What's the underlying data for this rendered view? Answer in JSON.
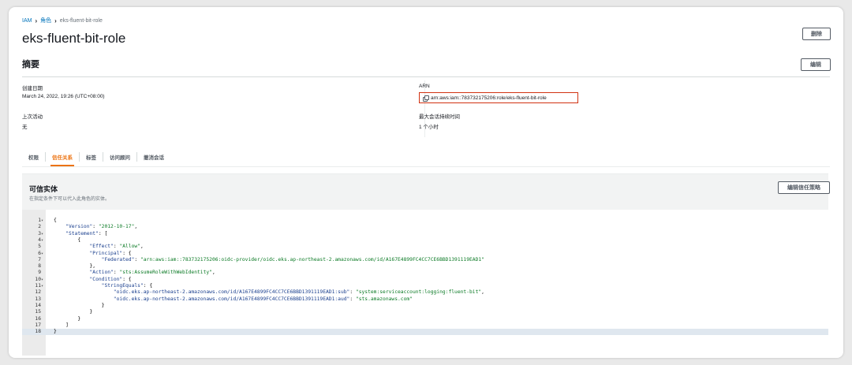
{
  "breadcrumb": [
    "IAM",
    "角色",
    "eks-fluent-bit-role"
  ],
  "page_title": "eks-fluent-bit-role",
  "buttons": {
    "delete": "删除",
    "edit": "编辑",
    "edit_trust_policy": "编辑信任策略"
  },
  "summary": {
    "title": "摘要",
    "created_label": "创建日期",
    "created_value": "March 24, 2022, 19:26 (UTC+08:00)",
    "last_activity_label": "上次活动",
    "last_activity_value": "无",
    "arn_label": "ARN",
    "arn_value": "arn:aws:iam::783732175206:role/eks-fluent-bit-role",
    "max_session_label": "最大会话持续时间",
    "max_session_value": "1 个小时"
  },
  "tabs": [
    "权限",
    "信任关系",
    "标签",
    "访问顾问",
    "撤消会话"
  ],
  "active_tab": "信任关系",
  "trust": {
    "title": "可信实体",
    "description": "在指定条件下可以代入此角色的实体。"
  },
  "code_lines": [
    {
      "n": "1",
      "fold": true,
      "text": "{"
    },
    {
      "n": "2",
      "fold": false,
      "text": "    \"Version\": \"2012-10-17\","
    },
    {
      "n": "3",
      "fold": true,
      "text": "    \"Statement\": ["
    },
    {
      "n": "4",
      "fold": true,
      "text": "        {"
    },
    {
      "n": "5",
      "fold": false,
      "text": "            \"Effect\": \"Allow\","
    },
    {
      "n": "6",
      "fold": true,
      "text": "            \"Principal\": {"
    },
    {
      "n": "7",
      "fold": false,
      "text": "                \"Federated\": \"arn:aws:iam::783732175206:oidc-provider/oidc.eks.ap-northeast-2.amazonaws.com/id/A167E4899FC4CC7CE6BBD1391119EAD1\""
    },
    {
      "n": "8",
      "fold": false,
      "text": "            },"
    },
    {
      "n": "9",
      "fold": false,
      "text": "            \"Action\": \"sts:AssumeRoleWithWebIdentity\","
    },
    {
      "n": "10",
      "fold": true,
      "text": "            \"Condition\": {"
    },
    {
      "n": "11",
      "fold": true,
      "text": "                \"StringEquals\": {"
    },
    {
      "n": "12",
      "fold": false,
      "text": "                    \"oidc.eks.ap-northeast-2.amazonaws.com/id/A167E4899FC4CC7CE6BBD1391119EAD1:sub\": \"system:serviceaccount:logging:fluent-bit\","
    },
    {
      "n": "13",
      "fold": false,
      "text": "                    \"oidc.eks.ap-northeast-2.amazonaws.com/id/A167E4899FC4CC7CE6BBD1391119EAD1:aud\": \"sts.amazonaws.com\""
    },
    {
      "n": "14",
      "fold": false,
      "text": "                }"
    },
    {
      "n": "15",
      "fold": false,
      "text": "            }"
    },
    {
      "n": "16",
      "fold": false,
      "text": "        }"
    },
    {
      "n": "17",
      "fold": false,
      "text": "    ]"
    },
    {
      "n": "18",
      "fold": false,
      "text": "}"
    }
  ],
  "highlighted_line": "18",
  "colors": {
    "accent": "#ec7211",
    "link": "#0073bb",
    "highlight_box": "#d13212"
  }
}
